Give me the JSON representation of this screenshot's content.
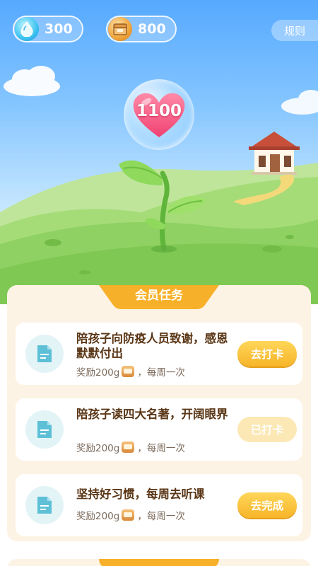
{
  "header": {
    "water_count": "300",
    "coin_count": "800",
    "rules_label": "规则",
    "water_icon": "water-drop-icon",
    "coin_icon": "treasure-chest-icon"
  },
  "garden": {
    "heart_value": "1100",
    "heart_icon": "heart-icon",
    "plant_icon": "sprout-icon",
    "house_icon": "house-icon"
  },
  "tasks": {
    "section_title": "会员任务",
    "items": [
      {
        "title": "陪孩子向防疫人员致谢，感恩默默付出",
        "reward_prefix": "奖励200g",
        "frequency": "每周一次",
        "button_label": "去打卡",
        "button_state": "active"
      },
      {
        "title": "陪孩子读四大名著，开阔眼界",
        "reward_prefix": "奖励200g",
        "frequency": "每周一次",
        "button_label": "已打卡",
        "button_state": "done"
      },
      {
        "title": "坚持好习惯，每周去听课",
        "reward_prefix": "奖励200g",
        "frequency": "每周一次",
        "button_label": "去完成",
        "button_state": "active"
      }
    ],
    "separator": "，"
  },
  "colors": {
    "accent": "#f7b529",
    "title_text": "#5a3616",
    "panel_bg": "#fdf3e4"
  }
}
